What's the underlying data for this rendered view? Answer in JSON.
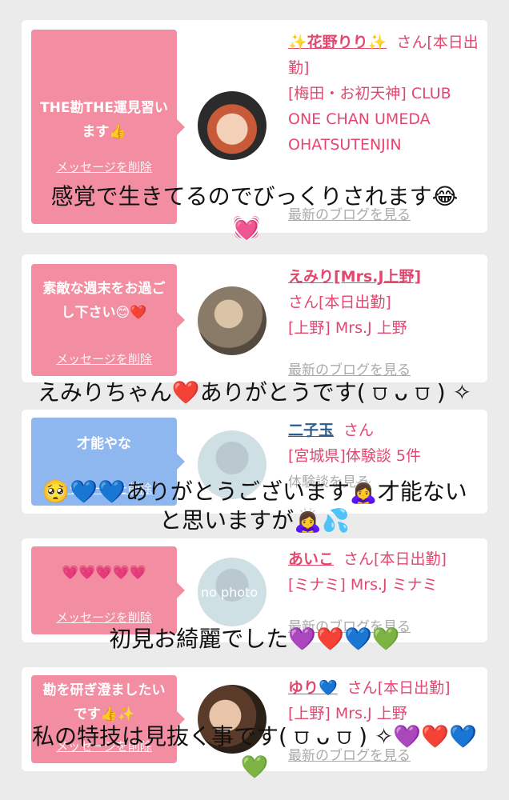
{
  "delete_label": "メッセージを削除",
  "blog_label": "最新のブログを見る",
  "san_label": "さん",
  "cards": [
    {
      "message": "THE勘THE運見習います👍",
      "name": "✨花野りり✨",
      "status": "[本日出勤]",
      "shop": "[梅田・お初天神] CLUB ONE CHAN UMEDA OHATSUTENJIN"
    },
    {
      "message": "素敵な週末をお過ごし下さい😊❤️",
      "name": "えみり[Mrs.J上野]",
      "status": "[本日出勤]",
      "shop": "[上野] Mrs.J 上野"
    },
    {
      "message": "才能やな",
      "name": "二子玉",
      "status": "",
      "shop": "[宮城県]体験談 5件",
      "extra": "体験談を見る"
    },
    {
      "message": "💗💗💗💗💗",
      "name": "あいこ",
      "status": "[本日出勤]",
      "shop": "[ミナミ] Mrs.J ミナミ",
      "avatar_text": "no photo"
    },
    {
      "message": "勘を研ぎ澄ましたいです👍✨",
      "name": "ゆり💙",
      "status": "[本日出勤]",
      "shop": "[上野] Mrs.J 上野"
    }
  ],
  "captions": [
    "感覚で生きてるのでびっくりされます😂",
    "💓",
    "えみりちゃん❤️ありがとうです( ⩌ ᴗ ⩌ ) ✧",
    "🥺💙💙ありがとうございます🙇‍♀️才能ない",
    "と思いますが🙇‍♀️💦",
    "初見お綺麗でした💜❤️💙💚",
    "私の特技は見抜く事です( ⩌ ᴗ ⩌ ) ✧💜❤️💙",
    "💚"
  ],
  "colors": {
    "pink_bubble": "#f38ea2",
    "blue_bubble": "#8fb7ef",
    "link_pink": "#e2486e",
    "link_blue": "#2a5c8e",
    "background": "#ebebeb"
  }
}
